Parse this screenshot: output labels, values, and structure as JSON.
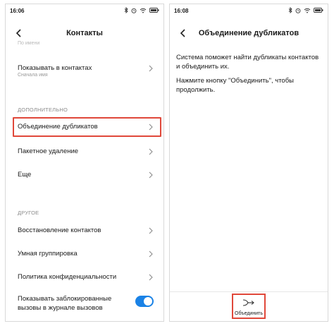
{
  "left_screen": {
    "status_time": "16:06",
    "title": "Контакты",
    "faded_top_text": "По имени",
    "rows": [
      {
        "title": "Показывать в контактах",
        "subtitle": "Сначала имя"
      }
    ],
    "section_additional": "ДОПОЛНИТЕЛЬНО",
    "additional_items": [
      {
        "title": "Объединение дубликатов"
      },
      {
        "title": "Пакетное удаление"
      },
      {
        "title": "Еще"
      }
    ],
    "section_other": "ДРУГОЕ",
    "other_items": [
      {
        "title": "Восстановление контактов"
      },
      {
        "title": "Умная группировка"
      },
      {
        "title": "Политика конфиденциальности"
      }
    ],
    "toggle": {
      "line1": "Показывать заблокированные",
      "line2": "вызовы в журнале вызовов",
      "state": "on"
    }
  },
  "right_screen": {
    "status_time": "16:08",
    "title": "Объединение дубликатов",
    "paragraph1": "Система поможет найти дубликаты контактов и объединить их.",
    "paragraph2": "Нажмите кнопку \"Объединить\", чтобы продолжить.",
    "merge_button_label": "Объединить"
  },
  "colors": {
    "highlight": "#e0483a",
    "toggle_on": "#1a82e6"
  },
  "icons": {
    "back": "chevron-left-icon",
    "row_arrow": "chevron-right-icon",
    "merge": "merge-arrows-icon",
    "status": [
      "bluetooth-icon",
      "alarm-icon",
      "wifi-icon",
      "battery-icon"
    ]
  }
}
